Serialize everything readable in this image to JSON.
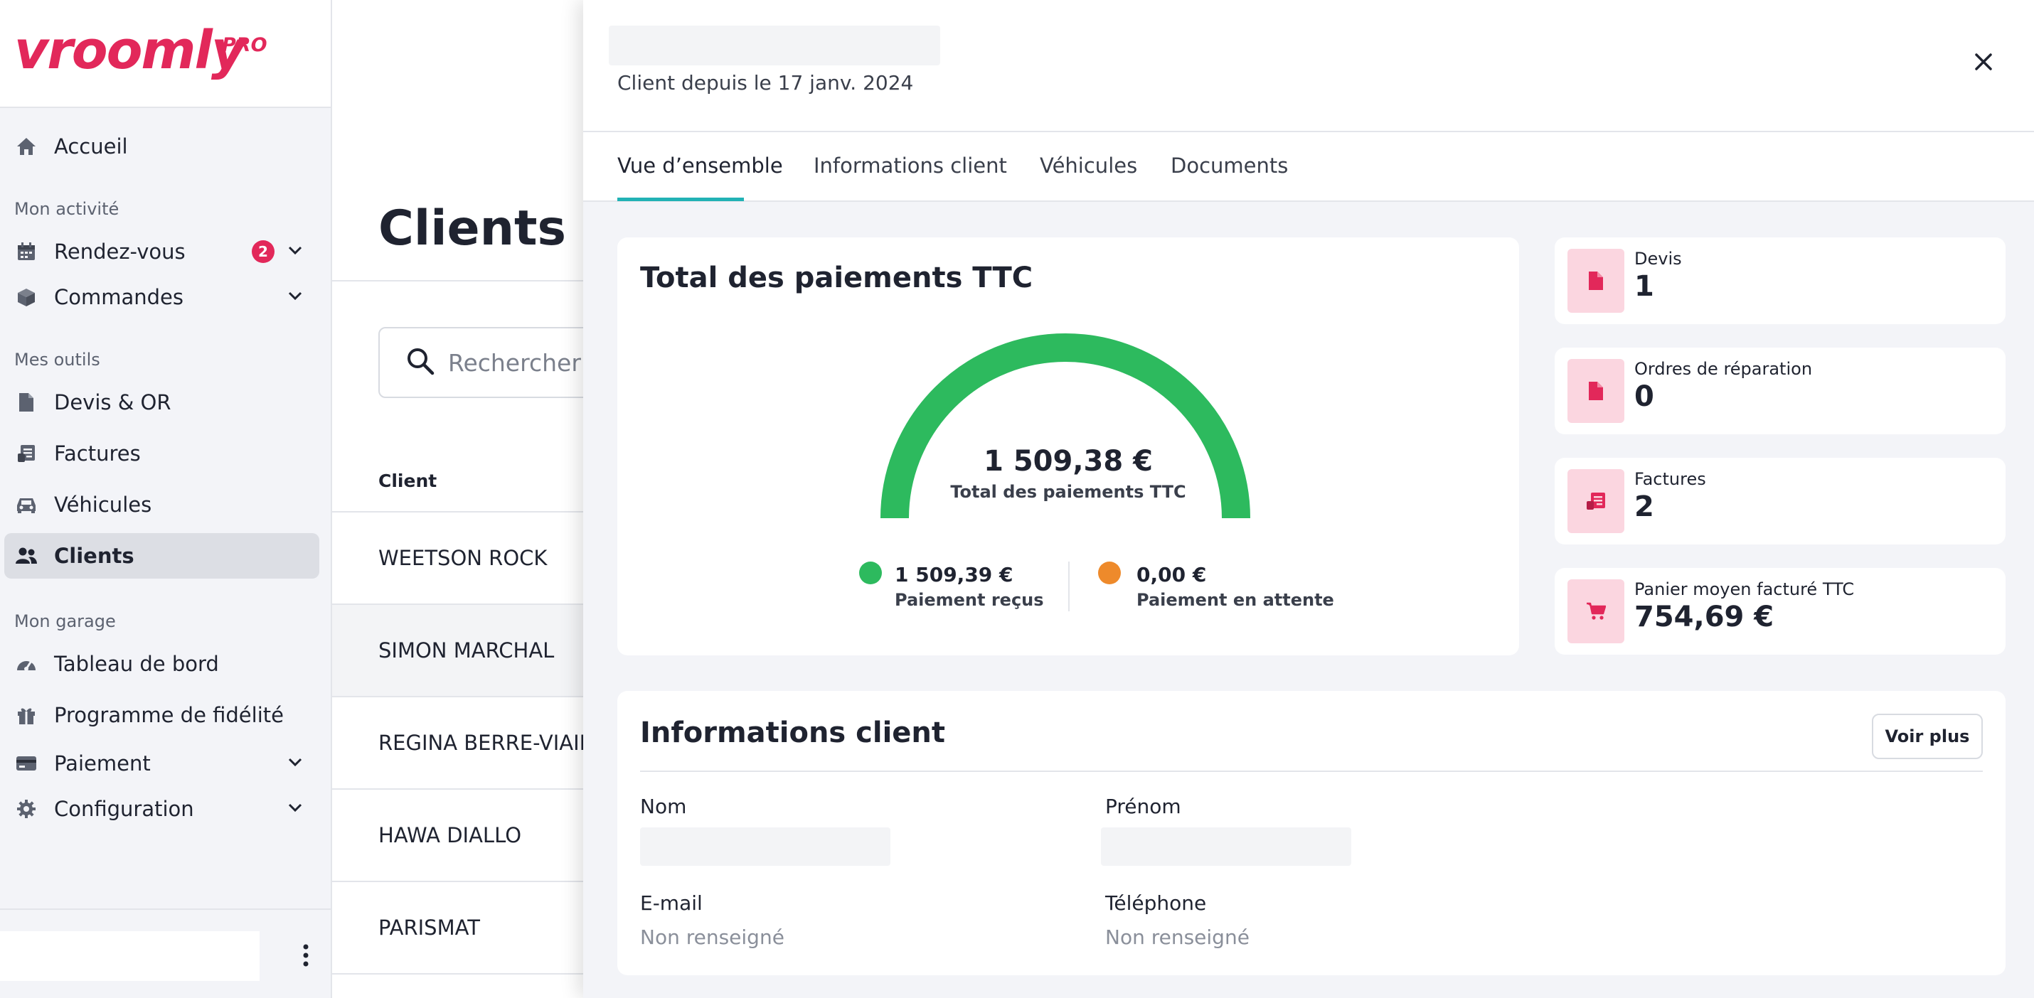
{
  "brand": {
    "name": "vroomly",
    "tag": "PRO"
  },
  "sidebar": {
    "home": "Accueil",
    "sections": {
      "activity": "Mon activité",
      "tools": "Mes outils",
      "garage": "Mon garage"
    },
    "appointments": {
      "label": "Rendez-vous",
      "badge": "2"
    },
    "orders": "Commandes",
    "quotes": "Devis & OR",
    "invoices": "Factures",
    "vehicles": "Véhicules",
    "clients": "Clients",
    "dashboard": "Tableau de bord",
    "loyalty": "Programme de fidélité",
    "payment": "Paiement",
    "configuration": "Configuration"
  },
  "main": {
    "title": "Clients",
    "search_placeholder": "Rechercher",
    "column_client": "Client",
    "rows": [
      "WEETSON ROCK",
      "SIMON MARCHAL",
      "REGINA BERRE-VIAIL",
      "HAWA DIALLO",
      "PARISMAT"
    ]
  },
  "drawer": {
    "client_since": "Client depuis le 17 janv. 2024",
    "tabs": [
      "Vue d’ensemble",
      "Informations client",
      "Véhicules",
      "Documents"
    ],
    "payments": {
      "title": "Total des paiements TTC",
      "total": "1 509,38 €",
      "total_label": "Total des paiements TTC",
      "received_value": "1 509,39 €",
      "received_label": "Paiement reçus",
      "pending_value": "0,00 €",
      "pending_label": "Paiement en attente",
      "received_fraction": 1.0,
      "received_color": "#2dba5e",
      "pending_color": "#ee8a2b"
    },
    "stats": [
      {
        "label": "Devis",
        "value": "1",
        "icon": "document-icon"
      },
      {
        "label": "Ordres de réparation",
        "value": "0",
        "icon": "document-icon"
      },
      {
        "label": "Factures",
        "value": "2",
        "icon": "invoice-icon"
      },
      {
        "label": "Panier moyen facturé TTC",
        "value": "754,69 €",
        "icon": "cart-icon"
      }
    ],
    "info": {
      "title": "Informations client",
      "more_button": "Voir plus",
      "last_name_label": "Nom",
      "first_name_label": "Prénom",
      "email_label": "E-mail",
      "email_value": "Non renseigné",
      "phone_label": "Téléphone",
      "phone_value": "Non renseigné"
    }
  },
  "colors": {
    "brand": "#e2285a",
    "accent": "#21b2b5",
    "success": "#2dba5e",
    "warning": "#ee8a2b"
  }
}
